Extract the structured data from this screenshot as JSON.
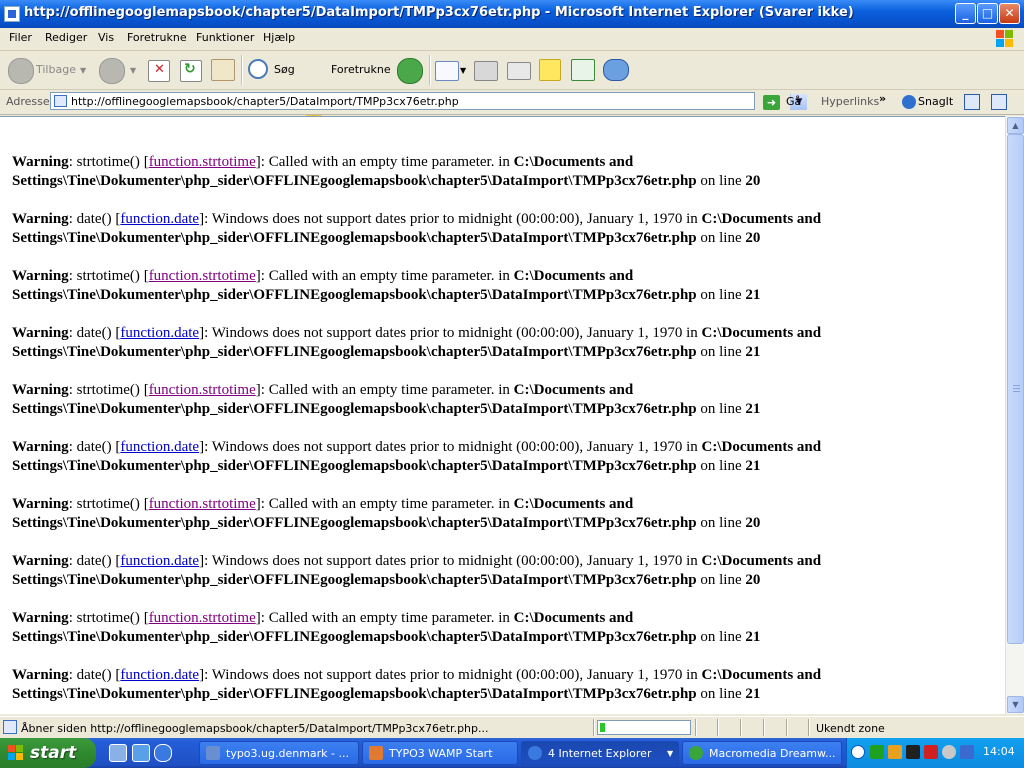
{
  "window": {
    "title": "http://offlinegooglemapsbook/chapter5/DataImport/TMPp3cx76etr.php - Microsoft Internet Explorer (Svarer ikke)",
    "minimize": "_",
    "maximize": "□",
    "close": "✕"
  },
  "menu": [
    "Filer",
    "Rediger",
    "Vis",
    "Foretrukne",
    "Funktioner",
    "Hjælp"
  ],
  "toolbar": {
    "back": "Tilbage",
    "search": "Søg",
    "favorites": "Foretrukne"
  },
  "address": {
    "label": "Adresse",
    "url": "http://offlinegooglemapsbook/chapter5/DataImport/TMPp3cx76etr.php",
    "go": "Gå",
    "links": "Hyperlinks",
    "links_chevron": "»",
    "snagit": "SnagIt"
  },
  "warnings": [
    {
      "label": "Warning",
      "fn": "strtotime()",
      "link": "function.strtotime",
      "visited": true,
      "msg": "Called with an empty time parameter. in",
      "path": "C:\\Documents and Settings\\Tine\\Dokumenter\\php_sider\\OFFLINEgooglemapsbook\\chapter5\\DataImport\\TMPp3cx76etr.php",
      "online": "on line",
      "line": "20"
    },
    {
      "label": "Warning",
      "fn": "date()",
      "link": "function.date",
      "visited": false,
      "msg": "Windows does not support dates prior to midnight (00:00:00), January 1, 1970 in",
      "path": "C:\\Documents and Settings\\Tine\\Dokumenter\\php_sider\\OFFLINEgooglemapsbook\\chapter5\\DataImport\\TMPp3cx76etr.php",
      "online": "on line",
      "line": "20"
    },
    {
      "label": "Warning",
      "fn": "strtotime()",
      "link": "function.strtotime",
      "visited": true,
      "msg": "Called with an empty time parameter. in",
      "path": "C:\\Documents and Settings\\Tine\\Dokumenter\\php_sider\\OFFLINEgooglemapsbook\\chapter5\\DataImport\\TMPp3cx76etr.php",
      "online": "on line",
      "line": "21"
    },
    {
      "label": "Warning",
      "fn": "date()",
      "link": "function.date",
      "visited": false,
      "msg": "Windows does not support dates prior to midnight (00:00:00), January 1, 1970 in",
      "path": "C:\\Documents and Settings\\Tine\\Dokumenter\\php_sider\\OFFLINEgooglemapsbook\\chapter5\\DataImport\\TMPp3cx76etr.php",
      "online": "on line",
      "line": "21"
    },
    {
      "label": "Warning",
      "fn": "strtotime()",
      "link": "function.strtotime",
      "visited": true,
      "msg": "Called with an empty time parameter. in",
      "path": "C:\\Documents and Settings\\Tine\\Dokumenter\\php_sider\\OFFLINEgooglemapsbook\\chapter5\\DataImport\\TMPp3cx76etr.php",
      "online": "on line",
      "line": "21"
    },
    {
      "label": "Warning",
      "fn": "date()",
      "link": "function.date",
      "visited": false,
      "msg": "Windows does not support dates prior to midnight (00:00:00), January 1, 1970 in",
      "path": "C:\\Documents and Settings\\Tine\\Dokumenter\\php_sider\\OFFLINEgooglemapsbook\\chapter5\\DataImport\\TMPp3cx76etr.php",
      "online": "on line",
      "line": "21"
    },
    {
      "label": "Warning",
      "fn": "strtotime()",
      "link": "function.strtotime",
      "visited": true,
      "msg": "Called with an empty time parameter. in",
      "path": "C:\\Documents and Settings\\Tine\\Dokumenter\\php_sider\\OFFLINEgooglemapsbook\\chapter5\\DataImport\\TMPp3cx76etr.php",
      "online": "on line",
      "line": "20"
    },
    {
      "label": "Warning",
      "fn": "date()",
      "link": "function.date",
      "visited": false,
      "msg": "Windows does not support dates prior to midnight (00:00:00), January 1, 1970 in",
      "path": "C:\\Documents and Settings\\Tine\\Dokumenter\\php_sider\\OFFLINEgooglemapsbook\\chapter5\\DataImport\\TMPp3cx76etr.php",
      "online": "on line",
      "line": "20"
    },
    {
      "label": "Warning",
      "fn": "strtotime()",
      "link": "function.strtotime",
      "visited": true,
      "msg": "Called with an empty time parameter. in",
      "path": "C:\\Documents and Settings\\Tine\\Dokumenter\\php_sider\\OFFLINEgooglemapsbook\\chapter5\\DataImport\\TMPp3cx76etr.php",
      "online": "on line",
      "line": "21"
    },
    {
      "label": "Warning",
      "fn": "date()",
      "link": "function.date",
      "visited": false,
      "msg": "Windows does not support dates prior to midnight (00:00:00), January 1, 1970 in",
      "path": "C:\\Documents and Settings\\Tine\\Dokumenter\\php_sider\\OFFLINEgooglemapsbook\\chapter5\\DataImport\\TMPp3cx76etr.php",
      "online": "on line",
      "line": "21"
    }
  ],
  "status": {
    "text": "Åbner siden http://offlinegooglemapsbook/chapter5/DataImport/TMPp3cx76etr.php...",
    "progress_fraction": 0.06,
    "zone": "Ukendt zone"
  },
  "taskbar": {
    "start": "start",
    "tasks": [
      {
        "label": "typo3.ug.denmark - ...",
        "icon_color": "#6a8fd0"
      },
      {
        "label": "TYPO3 WAMP Start",
        "icon_color": "#e07a30"
      },
      {
        "label": "4 Internet Explorer",
        "icon_color": "#3a7ae0"
      },
      {
        "label": "Macromedia Dreamw...",
        "icon_color": "#3aa63a"
      }
    ],
    "clock": "14:04"
  },
  "colors": {
    "link": "#0000cc",
    "visited_link": "#800080",
    "taskbar": "#245dda",
    "start_green": "#2f8a2f"
  }
}
